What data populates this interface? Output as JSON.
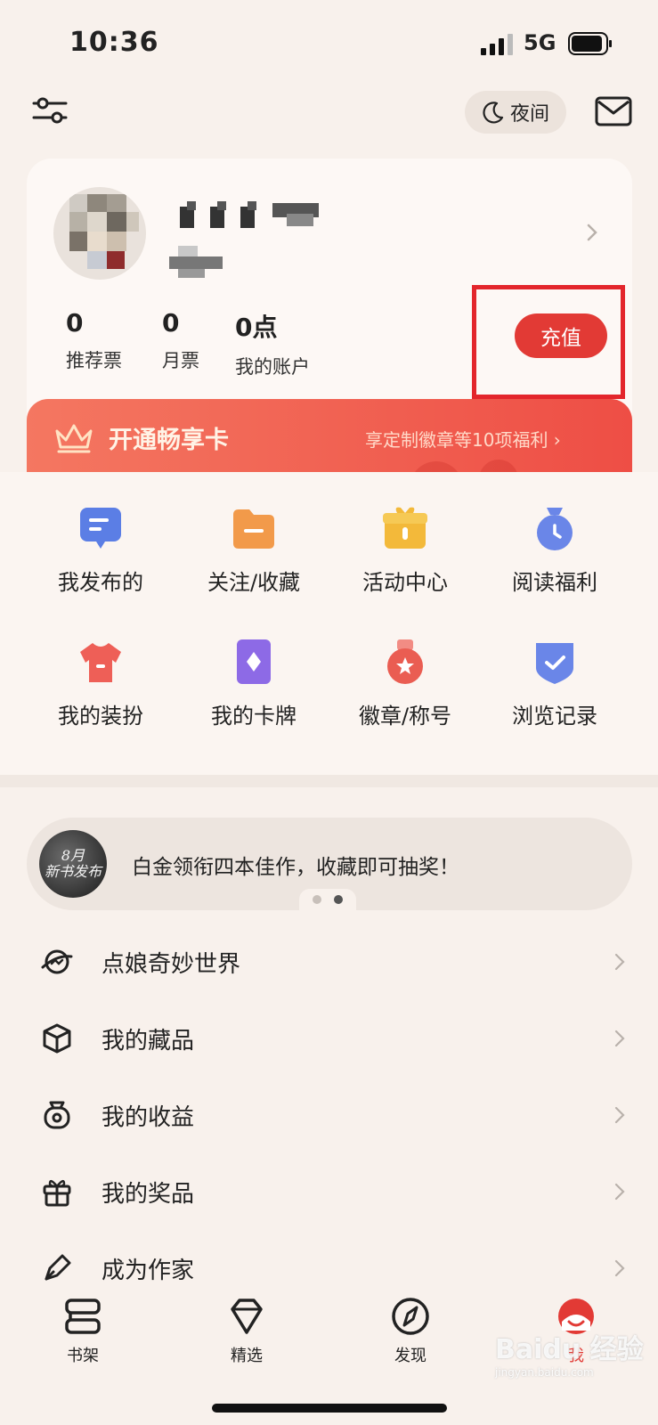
{
  "status_bar": {
    "time": "10:36",
    "network": "5G"
  },
  "top_bar": {
    "night_label": "夜间"
  },
  "profile": {
    "stats": [
      {
        "value": "0",
        "label": "推荐票"
      },
      {
        "value": "0",
        "label": "月票"
      },
      {
        "value": "0点",
        "label": "我的账户"
      }
    ],
    "recharge_label": "充值"
  },
  "vip": {
    "title": "开通畅享卡",
    "desc": "享定制徽章等10项福利 ›"
  },
  "grid": [
    {
      "label": "我发布的",
      "icon": "chat-bubble-icon",
      "color": "#5b7ee5"
    },
    {
      "label": "关注/收藏",
      "icon": "folder-icon",
      "color": "#f29a4a"
    },
    {
      "label": "活动中心",
      "icon": "gift-box-icon",
      "color": "#f3b93a"
    },
    {
      "label": "阅读福利",
      "icon": "clock-bag-icon",
      "color": "#6a86e8"
    },
    {
      "label": "我的装扮",
      "icon": "tshirt-icon",
      "color": "#ee5f57"
    },
    {
      "label": "我的卡牌",
      "icon": "card-icon",
      "color": "#8d6ae6"
    },
    {
      "label": "徽章/称号",
      "icon": "medal-icon",
      "color": "#ea5d52"
    },
    {
      "label": "浏览记录",
      "icon": "shield-check-icon",
      "color": "#6a86e8"
    }
  ],
  "banner": {
    "text": "白金领衔四本佳作，收藏即可抽奖！",
    "thumb_line1": "8月",
    "thumb_line2": "新书发布"
  },
  "menu": [
    {
      "label": "点娘奇妙世界",
      "icon": "planet-icon"
    },
    {
      "label": "我的藏品",
      "icon": "cube-icon"
    },
    {
      "label": "我的收益",
      "icon": "money-bag-icon"
    },
    {
      "label": "我的奖品",
      "icon": "gift-icon"
    },
    {
      "label": "成为作家",
      "icon": "pen-icon"
    }
  ],
  "tabs": [
    {
      "label": "书架",
      "icon": "bookshelf-icon"
    },
    {
      "label": "精选",
      "icon": "diamond-icon"
    },
    {
      "label": "发现",
      "icon": "compass-icon"
    },
    {
      "label": "我",
      "icon": "profile-mascot-icon"
    }
  ],
  "watermark": {
    "text": "Baidu 经验",
    "sub": "jingyan.baidu.com"
  },
  "colors": {
    "accent": "#e23a35",
    "highlight_box": "#e3262c",
    "background": "#f8f1ec"
  }
}
